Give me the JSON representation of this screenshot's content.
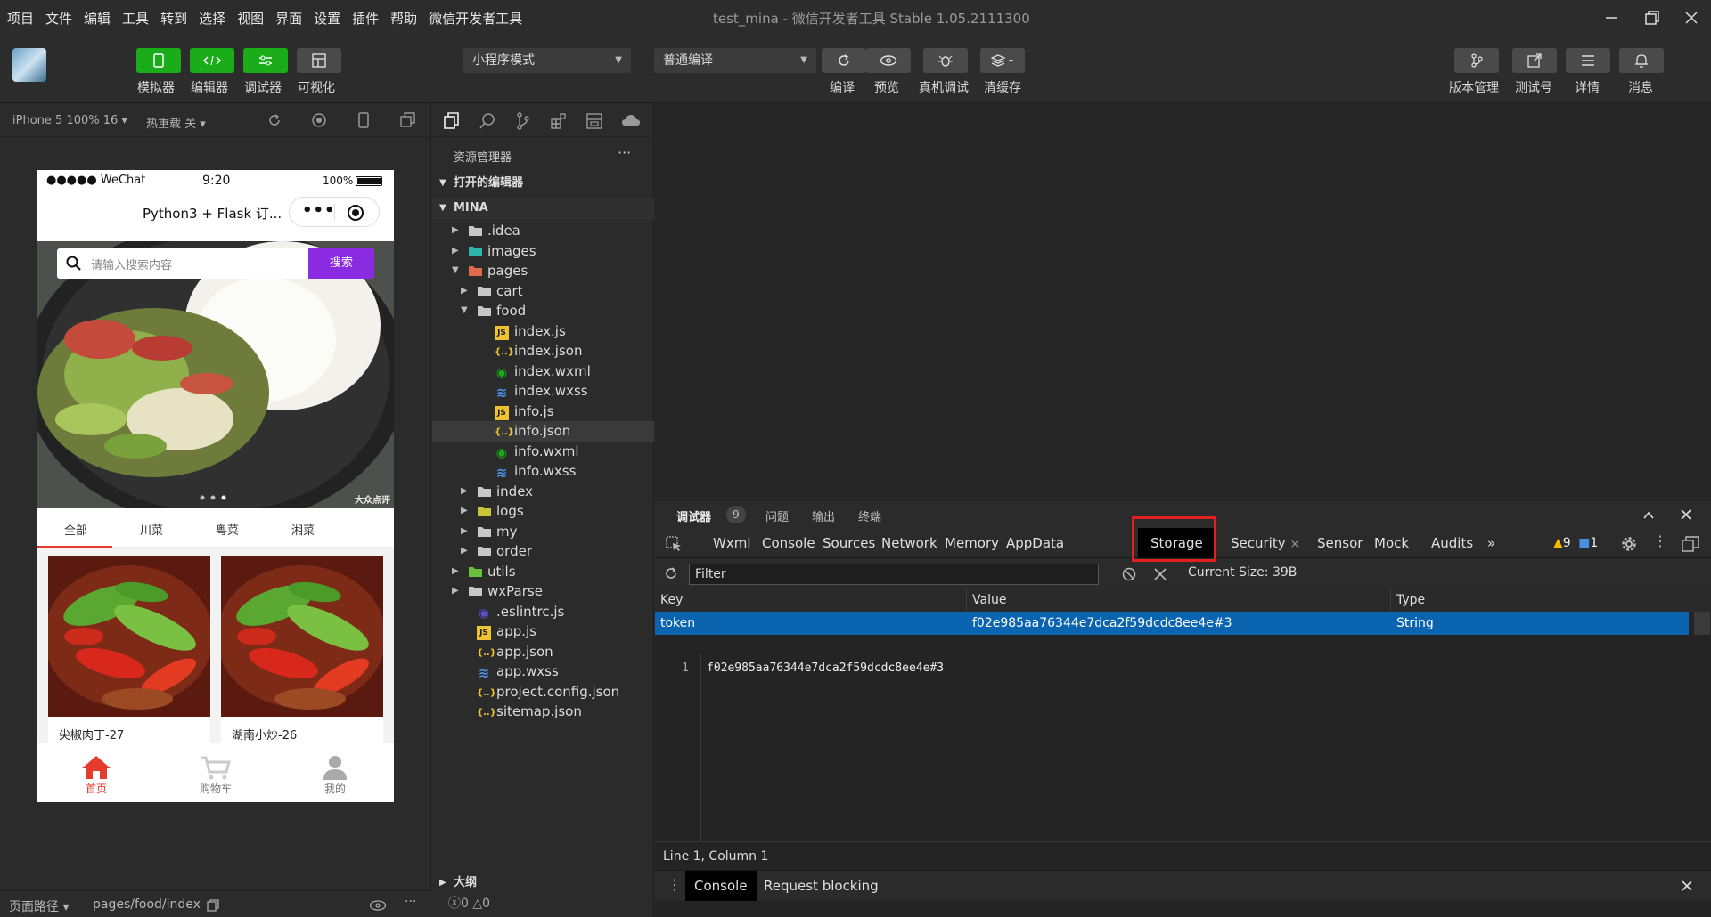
{
  "menubar": {
    "items": [
      "项目",
      "文件",
      "编辑",
      "工具",
      "转到",
      "选择",
      "视图",
      "界面",
      "设置",
      "插件",
      "帮助",
      "微信开发者工具"
    ],
    "title": "test_mina - 微信开发者工具 Stable 1.05.2111300"
  },
  "toolbar": {
    "left_buttons": [
      {
        "label": "模拟器",
        "icon": "phone-icon"
      },
      {
        "label": "编辑器",
        "icon": "code-icon"
      },
      {
        "label": "调试器",
        "icon": "debug-icon"
      },
      {
        "label": "可视化",
        "icon": "layout-icon"
      }
    ],
    "mode_select": "小程序模式",
    "compile_select": "普通编译",
    "mid_buttons": [
      {
        "label": "编译",
        "icon": "refresh-icon"
      },
      {
        "label": "预览",
        "icon": "eye-icon"
      },
      {
        "label": "真机调试",
        "icon": "bug-icon"
      },
      {
        "label": "清缓存",
        "icon": "layers-icon"
      }
    ],
    "right_buttons": [
      {
        "label": "版本管理",
        "icon": "branch-icon"
      },
      {
        "label": "测试号",
        "icon": "external-icon"
      },
      {
        "label": "详情",
        "icon": "menu-icon"
      },
      {
        "label": "消息",
        "icon": "bell-icon"
      }
    ]
  },
  "simulator": {
    "device": "iPhone 5 100% 16 ▾",
    "hotreload": "热重载 关 ▾",
    "status_carrier": "●●●●● WeChat",
    "status_time": "9:20",
    "status_battery": "100%",
    "nav_title": "Python3 + Flask 订...",
    "search_placeholder": "请输入搜索内容",
    "search_button": "搜索",
    "banner_watermark": "大众点评",
    "categories": [
      "全部",
      "川菜",
      "粤菜",
      "湘菜"
    ],
    "foods": [
      {
        "name": "尖椒肉丁-27"
      },
      {
        "name": "湖南小炒-26"
      }
    ],
    "tabs": [
      "首页",
      "购物车",
      "我的"
    ],
    "accent": "#e43b2c",
    "search_button_color": "#8a2be2"
  },
  "simbottom": {
    "path_label": "页面路径 ▾",
    "path": "pages/food/index"
  },
  "explorer": {
    "header": "资源管理器",
    "more": "···",
    "open_editors": "打开的编辑器",
    "project": "MINA",
    "outline": "大纲",
    "errors": "0",
    "warnings": "0",
    "tree": [
      {
        "name": ".idea",
        "type": "folder",
        "depth": 0,
        "open": false
      },
      {
        "name": "images",
        "type": "folder-img",
        "depth": 0,
        "open": false
      },
      {
        "name": "pages",
        "type": "folder-red",
        "depth": 0,
        "open": true
      },
      {
        "name": "cart",
        "type": "folder",
        "depth": 1,
        "open": false
      },
      {
        "name": "food",
        "type": "folder",
        "depth": 1,
        "open": true
      },
      {
        "name": "index.js",
        "type": "js",
        "depth": 2
      },
      {
        "name": "index.json",
        "type": "json",
        "depth": 2
      },
      {
        "name": "index.wxml",
        "type": "wxml",
        "depth": 2
      },
      {
        "name": "index.wxss",
        "type": "wxss",
        "depth": 2
      },
      {
        "name": "info.js",
        "type": "js",
        "depth": 2
      },
      {
        "name": "info.json",
        "type": "json",
        "depth": 2,
        "selected": true
      },
      {
        "name": "info.wxml",
        "type": "wxml",
        "depth": 2
      },
      {
        "name": "info.wxss",
        "type": "wxss",
        "depth": 2
      },
      {
        "name": "index",
        "type": "folder",
        "depth": 1,
        "open": false
      },
      {
        "name": "logs",
        "type": "folder-yellow",
        "depth": 1,
        "open": false
      },
      {
        "name": "my",
        "type": "folder",
        "depth": 1,
        "open": false
      },
      {
        "name": "order",
        "type": "folder",
        "depth": 1,
        "open": false
      },
      {
        "name": "utils",
        "type": "folder-green",
        "depth": 0,
        "open": false
      },
      {
        "name": "wxParse",
        "type": "folder",
        "depth": 0,
        "open": false
      },
      {
        "name": ".eslintrc.js",
        "type": "eslint",
        "depth": 0
      },
      {
        "name": "app.js",
        "type": "js",
        "depth": 0
      },
      {
        "name": "app.json",
        "type": "json",
        "depth": 0
      },
      {
        "name": "app.wxss",
        "type": "wxss",
        "depth": 0
      },
      {
        "name": "project.config.json",
        "type": "json",
        "depth": 0
      },
      {
        "name": "sitemap.json",
        "type": "json",
        "depth": 0
      }
    ]
  },
  "devtools": {
    "header_tabs": [
      "调试器",
      "问题",
      "输出",
      "终端"
    ],
    "debugger_badge": "9",
    "tabs": [
      "Wxml",
      "Console",
      "Sources",
      "Network",
      "Memory",
      "AppData",
      "Storage",
      "Security",
      "Sensor",
      "Mock",
      "Audits"
    ],
    "active_tab": "Storage",
    "more_tabs": "»",
    "warning_count": "9",
    "info_count": "1",
    "filter_placeholder": "Filter",
    "current_size": "Current Size: 39B",
    "columns": [
      "Key",
      "Value",
      "Type"
    ],
    "rows": [
      {
        "key": "token",
        "value": "f02e985aa76344e7dca2f59dcdc8ee4e#3",
        "type": "String"
      }
    ],
    "preview_line_no": "1",
    "preview_text": "f02e985aa76344e7dca2f59dcdc8ee4e#3",
    "status": "Line 1, Column 1",
    "drawer_tabs": [
      "Console",
      "Request blocking"
    ]
  }
}
